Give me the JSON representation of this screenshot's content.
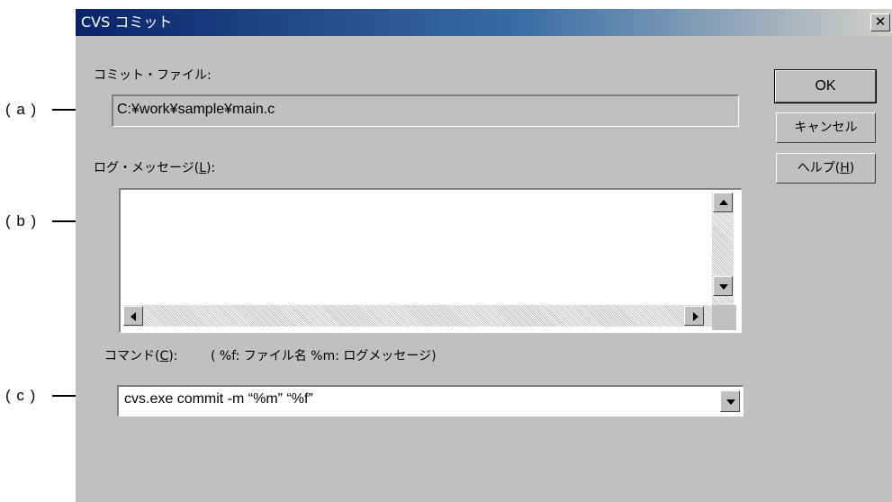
{
  "window": {
    "title": "CVS コミット",
    "close_glyph": "✕"
  },
  "commit_file": {
    "label": "コミット・ファイル:",
    "value": "C:¥work¥sample¥main.c"
  },
  "log_message": {
    "label_prefix": "ログ・メッセージ(",
    "label_mnemonic": "L",
    "label_suffix": "):",
    "value": ""
  },
  "command": {
    "label_prefix": "コマンド(",
    "label_mnemonic": "C",
    "label_suffix": "):",
    "hint": "( %f: ファイル名 %m: ログメッセージ)",
    "value": "cvs.exe commit -m “%m” “%f”"
  },
  "buttons": {
    "ok": "OK",
    "cancel": "キャンセル",
    "help_prefix": "ヘルプ(",
    "help_mnemonic": "H",
    "help_suffix": ")"
  },
  "callouts": {
    "a": "( a )",
    "b": "( b )",
    "c": "( c )"
  },
  "icons": {
    "close": "close-icon",
    "scroll_up": "arrow-up-icon",
    "scroll_down": "arrow-down-icon",
    "scroll_left": "arrow-left-icon",
    "scroll_right": "arrow-right-icon",
    "dropdown": "chevron-down-icon"
  },
  "colors": {
    "dialog_face": "#c0c0c0",
    "title_start": "#0a246a",
    "title_end": "#d4d0c8",
    "readonly_field": "#c0c0c0",
    "editable_field": "#ffffff"
  }
}
